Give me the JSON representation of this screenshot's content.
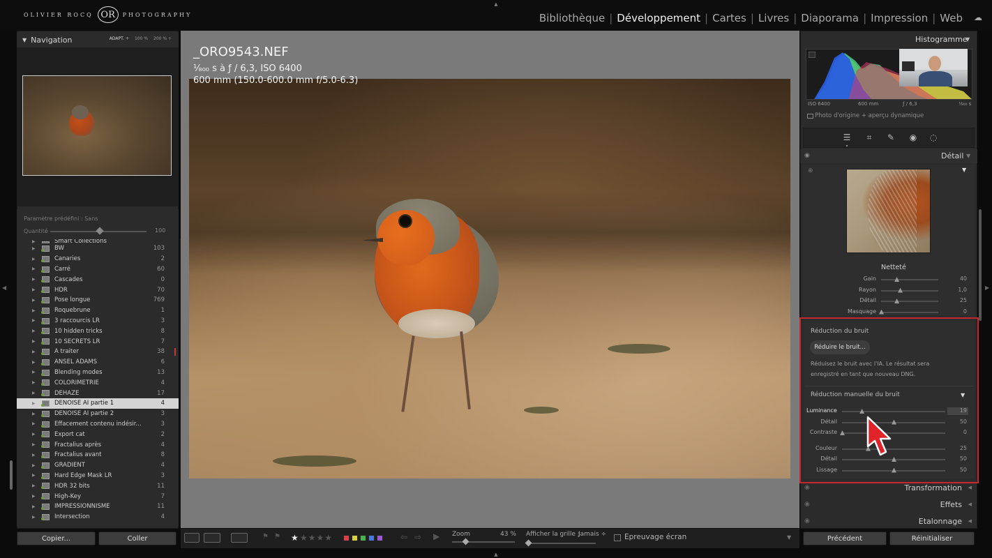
{
  "top": {
    "logo_left": "OLIVIER ROCQ",
    "logo_mark": "OR",
    "logo_right": "PHOTOGRAPHY",
    "modules": [
      "Bibliothèque",
      "Développement",
      "Cartes",
      "Livres",
      "Diaporama",
      "Impression",
      "Web"
    ],
    "active_module": "Développement"
  },
  "navigator": {
    "title": "Navigation",
    "zoom_options": [
      "ADAPT. ÷",
      "100 %",
      "200 % ÷"
    ]
  },
  "preset": {
    "name": "Paramètre prédéfini : Sans",
    "quantity_label": "Quantité",
    "quantity_value": "100"
  },
  "collections": [
    {
      "name": "Smart Collections",
      "count": ""
    },
    {
      "name": "BW",
      "count": "103"
    },
    {
      "name": "Canaries",
      "count": "2"
    },
    {
      "name": "Carré",
      "count": "60"
    },
    {
      "name": "Cascades",
      "count": "0"
    },
    {
      "name": "HDR",
      "count": "70"
    },
    {
      "name": "Pose longue",
      "count": "769"
    },
    {
      "name": "Roquebrune",
      "count": "1"
    },
    {
      "name": "3 raccourcis LR",
      "count": "3"
    },
    {
      "name": "10 hidden tricks",
      "count": "8"
    },
    {
      "name": "10 SECRETS LR",
      "count": "7"
    },
    {
      "name": "A traiter",
      "count": "38"
    },
    {
      "name": "ANSEL ADAMS",
      "count": "6"
    },
    {
      "name": "Blending modes",
      "count": "13"
    },
    {
      "name": "COLORIMETRIE",
      "count": "4"
    },
    {
      "name": "DEHAZE",
      "count": "17"
    },
    {
      "name": "DENOISE AI partie 1",
      "count": "4"
    },
    {
      "name": "DENOISE AI partie 2",
      "count": "3"
    },
    {
      "name": "Effacement contenu indésir...",
      "count": "3"
    },
    {
      "name": "Export cat",
      "count": "2"
    },
    {
      "name": "Fractalius après",
      "count": "4"
    },
    {
      "name": "Fractalius avant",
      "count": "8"
    },
    {
      "name": "GRADIENT",
      "count": "4"
    },
    {
      "name": "Hard Edge Mask LR",
      "count": "3"
    },
    {
      "name": "HDR 32 bits",
      "count": "11"
    },
    {
      "name": "High-Key",
      "count": "7"
    },
    {
      "name": "IMPRESSIONNISME",
      "count": "11"
    },
    {
      "name": "Intersection",
      "count": "4"
    }
  ],
  "selected_collection": "DENOISE AI partie 1",
  "left_buttons": {
    "copy": "Copier...",
    "paste": "Coller"
  },
  "photo": {
    "filename": "_ORO9543.NEF",
    "exposure": "¹⁄₈₀₀ s à ƒ / 6,3, ISO 6400",
    "lens": "600 mm (150.0-600.0 mm f/5.0-6.3)"
  },
  "toolbar": {
    "rating_filled": "★",
    "rating_empty": "★★★★",
    "zoom_label": "Zoom",
    "zoom_value": "43 %",
    "grid_label": "Afficher la grille :",
    "grid_value": "Jamais ÷",
    "proof_label": "Epreuvage écran",
    "color_labels": [
      "#d8404a",
      "#d8d040",
      "#4cb04c",
      "#4a7ad8",
      "#9a5ad0"
    ]
  },
  "histogram": {
    "title": "Histogramme",
    "iso": "ISO 6400",
    "focal": "600 mm",
    "aperture": "ƒ / 6,3",
    "shutter": "¹⁄₈₀₀ s",
    "preview_status": "Photo d'origine + aperçu dynamique"
  },
  "detail": {
    "title": "Détail",
    "sharpening_title": "Netteté",
    "sharpening": [
      {
        "label": "Gain",
        "value": "40",
        "pos": 0.27
      },
      {
        "label": "Rayon",
        "value": "1,0",
        "pos": 0.33
      },
      {
        "label": "Détail",
        "value": "25",
        "pos": 0.27
      },
      {
        "label": "Masquage",
        "value": "0",
        "pos": 0.0
      }
    ],
    "noise_reduction_title": "Réduction du bruit",
    "noise_button": "Réduire le bruit...",
    "noise_desc_line1": "Réduisez le bruit avec l'IA. Le résultat sera",
    "noise_desc_line2": "enregistré en tant que nouveau DNG.",
    "manual_title": "Réduction manuelle du bruit",
    "manual_sliders": [
      {
        "label": "Luminance",
        "value": "19",
        "pos": 0.19
      },
      {
        "label": "Détail",
        "value": "50",
        "pos": 0.5
      },
      {
        "label": "Contraste",
        "value": "0",
        "pos": 0.0
      },
      {
        "label": "Couleur",
        "value": "25",
        "pos": 0.25
      },
      {
        "label": "Détail",
        "value": "50",
        "pos": 0.5
      },
      {
        "label": "Lissage",
        "value": "50",
        "pos": 0.5
      }
    ]
  },
  "right_sections": [
    "Transformation",
    "Effets",
    "Etalonnage"
  ],
  "right_buttons": {
    "previous": "Précédent",
    "reset": "Réinitialiser"
  }
}
